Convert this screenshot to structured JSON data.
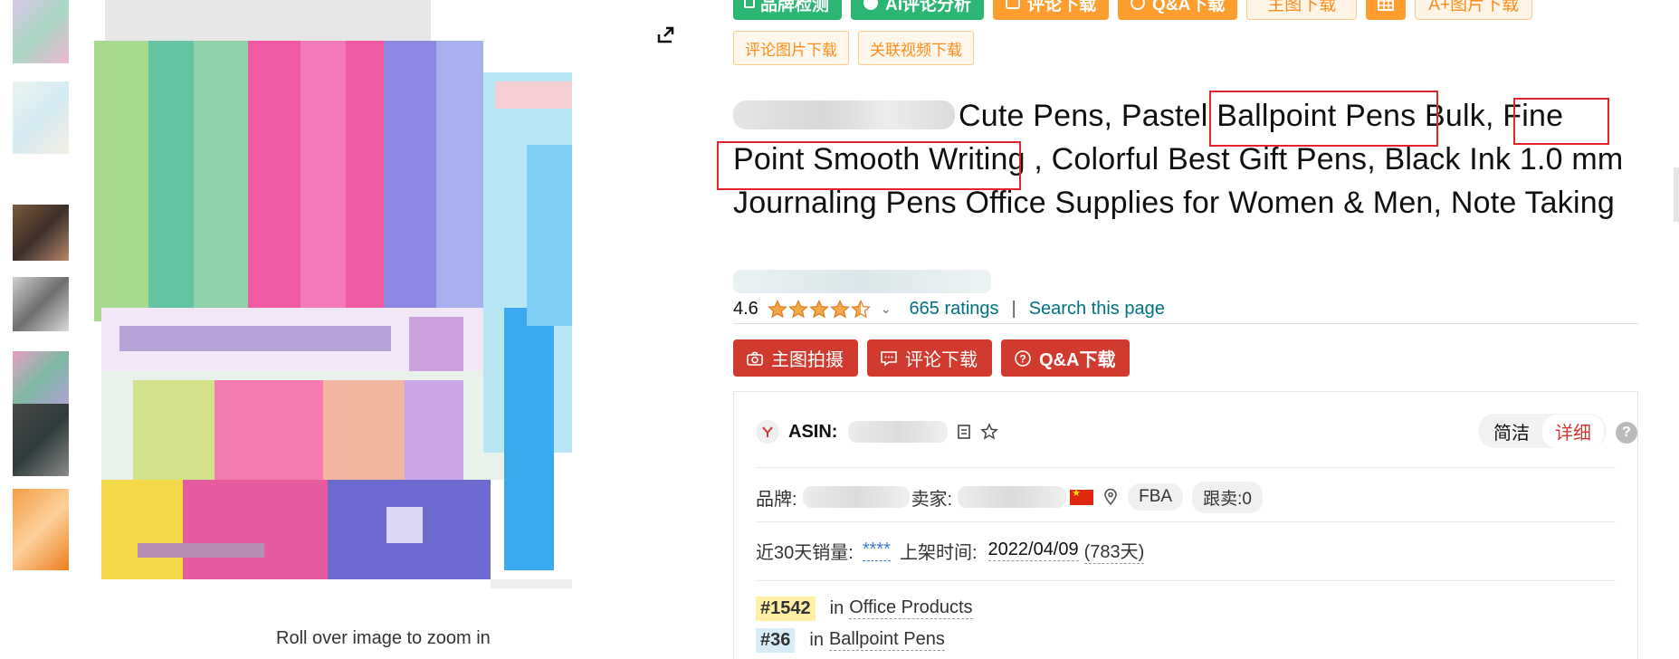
{
  "toolbar_top": {
    "buttons": [
      "品牌检测",
      "AI评论分析",
      "评论下载",
      "Q&A下载",
      "主图下载",
      "",
      "A+图片下载"
    ]
  },
  "toolbar_second": {
    "buttons": [
      "评论图片下载",
      "关联视频下载"
    ]
  },
  "image_area": {
    "zoom_hint": "Roll over image to zoom in"
  },
  "product": {
    "title": "Cute Pens, Pastel Ballpoint Pens Bulk, Fine Point Smooth Writing , Colorful Best Gift Pens, Black Ink 1.0 mm Journaling Pens Office Supplies for Women & Men, Note Taking",
    "rating_value": "4.6",
    "rating_stars": 4.5,
    "ratings_count": "665 ratings",
    "separator": "|",
    "search_link": "Search this page"
  },
  "action_buttons": {
    "main_image_shoot": "主图拍摄",
    "review_download": "评论下载",
    "qa_download": "Q&A下载"
  },
  "panel": {
    "asin_label": "ASIN:",
    "view_toggle": {
      "simple": "简洁",
      "detail": "详细"
    },
    "help": "?",
    "brand_label": "品牌:",
    "seller_label": "卖家:",
    "fba": "FBA",
    "follow_sellers": "跟卖:0",
    "sales_30d_label": "近30天销量:",
    "sales_30d_value": "****",
    "listing_date_label": "上架时间:",
    "listing_date": "2022/04/09",
    "listing_days": "(783天)",
    "ranks": [
      {
        "rank": "#1542",
        "in": "in",
        "category": "Office Products"
      },
      {
        "rank": "#36",
        "in": "in",
        "category": "Ballpoint Pens"
      }
    ]
  },
  "colors": {
    "green": "#2bb673",
    "orange": "#ff9d2e",
    "red": "#d13a2e",
    "link": "#007185",
    "highlight_box": "#e3242b",
    "star": "#f3a847"
  }
}
